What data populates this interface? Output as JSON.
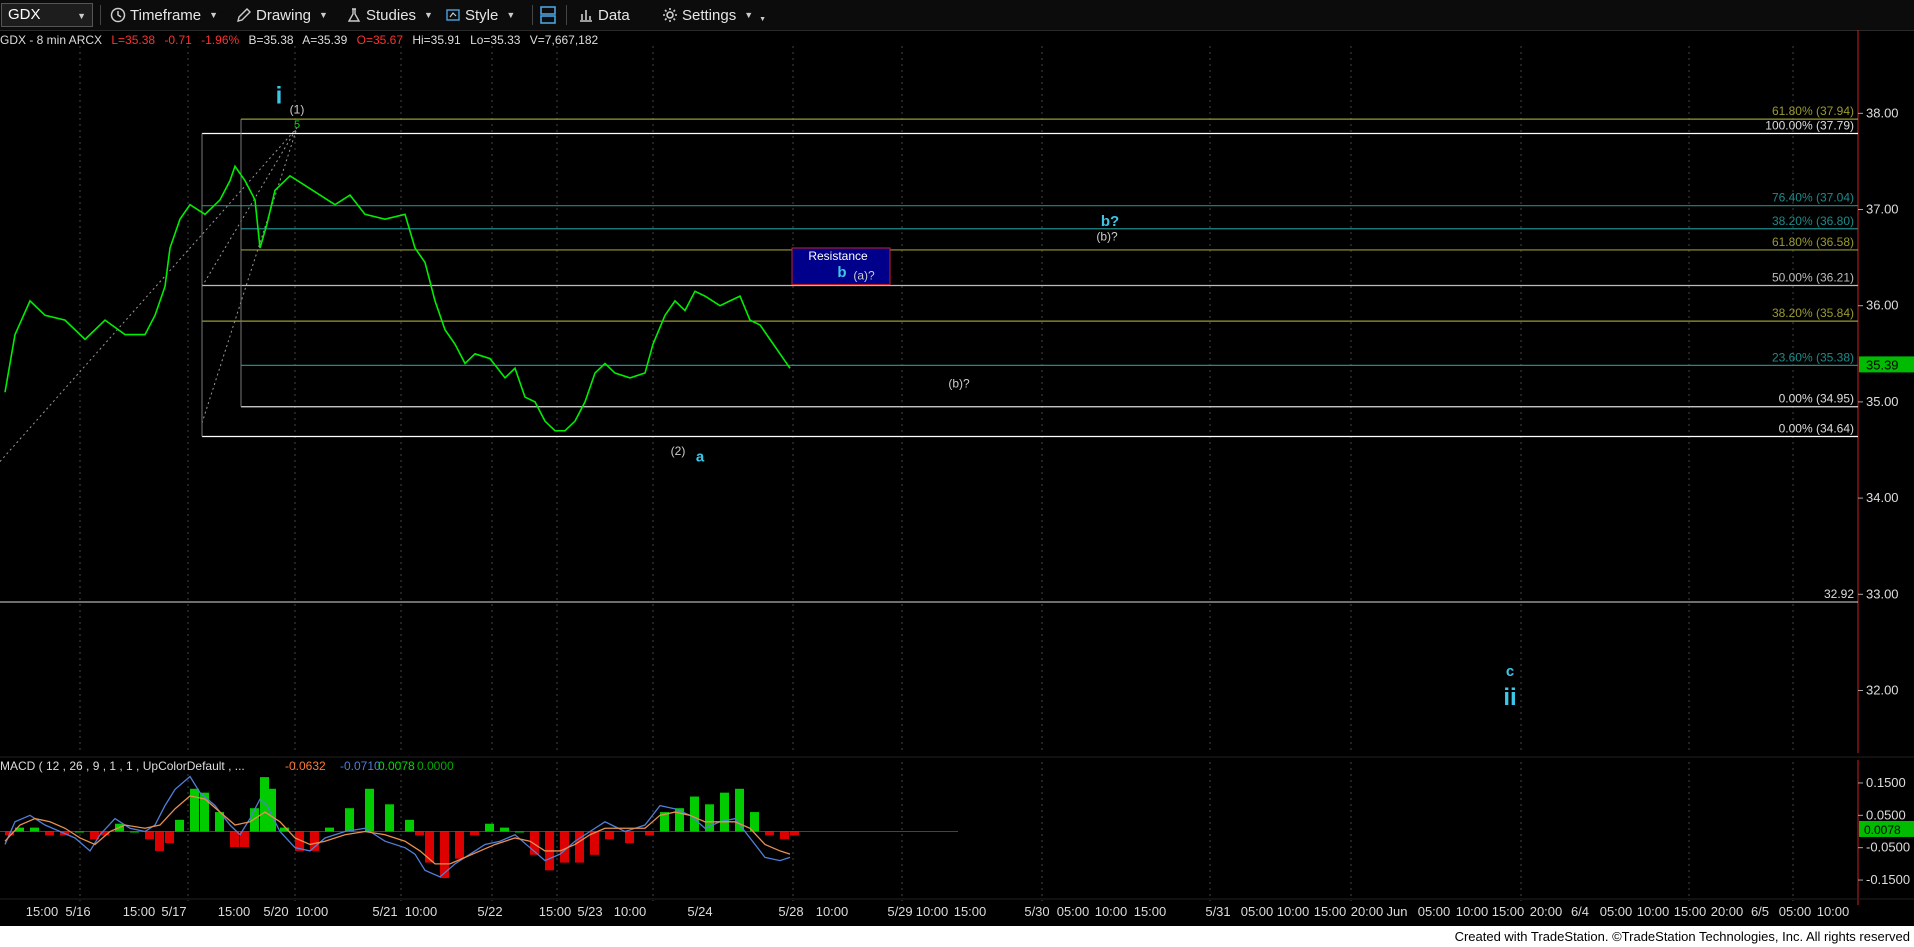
{
  "toolbar": {
    "symbol": "GDX",
    "timeframe_label": "Timeframe",
    "drawing_label": "Drawing",
    "studies_label": "Studies",
    "style_label": "Style",
    "data_label": "Data",
    "settings_label": "Settings"
  },
  "quote": {
    "symbol_info": "GDX - 8 min  ARCX",
    "last": "L=35.38",
    "change": "-0.71",
    "change_pct": "-1.96%",
    "bid": "B=35.38",
    "ask": "A=35.39",
    "open": "O=35.67",
    "high": "Hi=35.91",
    "low": "Lo=35.33",
    "volume": "V=7,667,182"
  },
  "footer": {
    "text": "Created with TradeStation. ©TradeStation Technologies, Inc. All rights reserved"
  },
  "colors": {
    "price": "#00ee00",
    "up_text": "#00dd00",
    "down_text": "#ff3030",
    "label_cyan": "#3ec6e8",
    "grid": "#444444",
    "macd_line": "#4f7fd8",
    "signal_line": "#e89050"
  },
  "chart_data": {
    "type": "line",
    "symbol": "GDX",
    "interval": "8 min",
    "current_price": "35.39",
    "y_ticks": [
      "38.00",
      "37.00",
      "36.00",
      "35.00",
      "34.00",
      "33.00",
      "32.00"
    ],
    "y_range": [
      31.35,
      38.7
    ],
    "x_ticks": [
      "15:00",
      "5/16",
      "15:00",
      "5/17",
      "15:00",
      "5/20",
      "10:00",
      "5/21",
      "10:00",
      "5/22",
      "15:00",
      "5/23",
      "10:00",
      "5/24",
      "5/28",
      "10:00",
      "5/29",
      "10:00",
      "15:00",
      "5/30",
      "05:00",
      "10:00",
      "15:00",
      "5/31",
      "05:00",
      "10:00",
      "15:00",
      "20:00",
      "Jun",
      "05:00",
      "10:00",
      "15:00",
      "20:00",
      "6/4",
      "05:00",
      "10:00",
      "15:00",
      "20:00",
      "6/5",
      "05:00",
      "10:00"
    ],
    "price_series": [
      [
        0,
        35.1
      ],
      [
        10,
        35.7
      ],
      [
        25,
        36.05
      ],
      [
        40,
        35.9
      ],
      [
        60,
        35.85
      ],
      [
        80,
        35.65
      ],
      [
        100,
        35.85
      ],
      [
        120,
        35.7
      ],
      [
        140,
        35.7
      ],
      [
        150,
        35.9
      ],
      [
        160,
        36.2
      ],
      [
        165,
        36.6
      ],
      [
        175,
        36.9
      ],
      [
        185,
        37.05
      ],
      [
        200,
        36.95
      ],
      [
        215,
        37.1
      ],
      [
        225,
        37.3
      ],
      [
        230,
        37.45
      ],
      [
        240,
        37.3
      ],
      [
        250,
        37.1
      ],
      [
        255,
        36.6
      ],
      [
        262,
        36.85
      ],
      [
        270,
        37.2
      ],
      [
        285,
        37.35
      ],
      [
        300,
        37.25
      ],
      [
        315,
        37.15
      ],
      [
        330,
        37.05
      ],
      [
        345,
        37.15
      ],
      [
        360,
        36.95
      ],
      [
        380,
        36.9
      ],
      [
        400,
        36.95
      ],
      [
        410,
        36.6
      ],
      [
        420,
        36.45
      ],
      [
        430,
        36.05
      ],
      [
        440,
        35.75
      ],
      [
        450,
        35.6
      ],
      [
        460,
        35.4
      ],
      [
        470,
        35.5
      ],
      [
        485,
        35.45
      ],
      [
        500,
        35.25
      ],
      [
        510,
        35.35
      ],
      [
        520,
        35.05
      ],
      [
        530,
        35.0
      ],
      [
        540,
        34.8
      ],
      [
        550,
        34.7
      ],
      [
        560,
        34.7
      ],
      [
        570,
        34.8
      ],
      [
        580,
        35.0
      ],
      [
        590,
        35.3
      ],
      [
        600,
        35.4
      ],
      [
        610,
        35.3
      ],
      [
        625,
        35.25
      ],
      [
        640,
        35.3
      ],
      [
        648,
        35.6
      ],
      [
        660,
        35.9
      ],
      [
        670,
        36.05
      ],
      [
        680,
        35.95
      ],
      [
        690,
        36.15
      ],
      [
        700,
        36.1
      ],
      [
        715,
        36.0
      ],
      [
        725,
        36.05
      ],
      [
        735,
        36.1
      ],
      [
        745,
        35.85
      ],
      [
        755,
        35.8
      ],
      [
        765,
        35.65
      ],
      [
        775,
        35.5
      ],
      [
        785,
        35.35
      ]
    ],
    "fib_lines": [
      {
        "label": "61.80% (37.94)",
        "value": 37.94,
        "color": "#9a9a30"
      },
      {
        "label": "100.00% (37.79)",
        "value": 37.79,
        "color": "#ffffff"
      },
      {
        "label": "76.40% (37.04)",
        "value": 37.04,
        "color": "#1e8a8a"
      },
      {
        "label": "38.20% (36.80)",
        "value": 36.8,
        "color": "#1e8a8a"
      },
      {
        "label": "61.80% (36.58)",
        "value": 36.58,
        "color": "#9a9a30"
      },
      {
        "label": "50.00% (36.21)",
        "value": 36.21,
        "color": "#bbbbbb"
      },
      {
        "label": "38.20% (35.84)",
        "value": 35.84,
        "color": "#9a9a30"
      },
      {
        "label": "23.60% (35.38)",
        "value": 35.38,
        "color": "#1e8a8a"
      },
      {
        "label": "0.00% (34.95)",
        "value": 34.95,
        "color": "#dddddd"
      },
      {
        "label": "0.00% (34.64)",
        "value": 34.64,
        "color": "#ffffff"
      }
    ],
    "support_line": {
      "label": "32.92",
      "value": 32.92
    },
    "resistance_box": {
      "label": "Resistance",
      "top": 36.6,
      "bottom": 36.22
    },
    "wave_labels": [
      {
        "text": "i",
        "value": 38.1
      },
      {
        "text": "(1)",
        "value": 38.0
      },
      {
        "text": "5",
        "value": 37.85
      },
      {
        "text": "(2)",
        "value": 34.45
      },
      {
        "text": "a",
        "value": 34.38
      },
      {
        "text": "b",
        "value": 36.3
      },
      {
        "text": "(a)?",
        "value": 36.27
      },
      {
        "text": "(b)?",
        "value": 35.15
      },
      {
        "text": "b?",
        "value": 36.83
      },
      {
        "text": "(b)?",
        "value": 36.68
      },
      {
        "text": "c",
        "value": 32.15
      },
      {
        "text": "ii",
        "value": 31.85
      }
    ],
    "macd": {
      "label": "MACD ( 12 , 26 , 9 , 1 , 1 , UpColorDefault , ...",
      "values": [
        "-0.0632",
        "-0.0710",
        "0.0078",
        "0.0000"
      ],
      "y_ticks": [
        "0.1500",
        "0.0500",
        "-0.0500",
        "-0.1500"
      ],
      "current": "0.0078",
      "y_range": [
        -0.19,
        0.19
      ],
      "macd_series": [
        [
          0,
          -0.04
        ],
        [
          10,
          0.03
        ],
        [
          25,
          0.05
        ],
        [
          40,
          0.02
        ],
        [
          55,
          0.0
        ],
        [
          70,
          -0.02
        ],
        [
          85,
          -0.06
        ],
        [
          95,
          -0.01
        ],
        [
          110,
          0.04
        ],
        [
          125,
          0.01
        ],
        [
          140,
          0.0
        ],
        [
          150,
          0.02
        ],
        [
          160,
          0.08
        ],
        [
          170,
          0.13
        ],
        [
          185,
          0.17
        ],
        [
          195,
          0.12
        ],
        [
          210,
          0.08
        ],
        [
          225,
          0.02
        ],
        [
          235,
          -0.01
        ],
        [
          245,
          0.04
        ],
        [
          255,
          0.1
        ],
        [
          262,
          0.08
        ],
        [
          275,
          0.0
        ],
        [
          290,
          -0.05
        ],
        [
          305,
          -0.06
        ],
        [
          320,
          -0.02
        ],
        [
          340,
          0.0
        ],
        [
          360,
          0.01
        ],
        [
          380,
          -0.03
        ],
        [
          400,
          -0.05
        ],
        [
          410,
          -0.07
        ],
        [
          420,
          -0.12
        ],
        [
          435,
          -0.14
        ],
        [
          450,
          -0.1
        ],
        [
          465,
          -0.07
        ],
        [
          480,
          -0.04
        ],
        [
          495,
          -0.03
        ],
        [
          510,
          -0.01
        ],
        [
          525,
          -0.05
        ],
        [
          540,
          -0.09
        ],
        [
          555,
          -0.07
        ],
        [
          570,
          -0.03
        ],
        [
          585,
          0.0
        ],
        [
          600,
          0.03
        ],
        [
          620,
          0.0
        ],
        [
          640,
          0.02
        ],
        [
          655,
          0.08
        ],
        [
          670,
          0.07
        ],
        [
          685,
          0.05
        ],
        [
          700,
          0.01
        ],
        [
          715,
          0.03
        ],
        [
          730,
          0.04
        ],
        [
          745,
          -0.02
        ],
        [
          760,
          -0.08
        ],
        [
          775,
          -0.09
        ],
        [
          785,
          -0.08
        ]
      ],
      "signal_series": [
        [
          0,
          -0.03
        ],
        [
          15,
          0.02
        ],
        [
          30,
          0.04
        ],
        [
          45,
          0.03
        ],
        [
          60,
          0.01
        ],
        [
          75,
          -0.02
        ],
        [
          90,
          -0.04
        ],
        [
          105,
          0.0
        ],
        [
          120,
          0.02
        ],
        [
          140,
          0.01
        ],
        [
          155,
          0.02
        ],
        [
          170,
          0.07
        ],
        [
          185,
          0.11
        ],
        [
          200,
          0.1
        ],
        [
          215,
          0.06
        ],
        [
          230,
          0.02
        ],
        [
          245,
          0.03
        ],
        [
          260,
          0.06
        ],
        [
          275,
          0.03
        ],
        [
          290,
          -0.02
        ],
        [
          305,
          -0.04
        ],
        [
          320,
          -0.03
        ],
        [
          340,
          -0.01
        ],
        [
          360,
          0.0
        ],
        [
          380,
          -0.01
        ],
        [
          400,
          -0.03
        ],
        [
          415,
          -0.06
        ],
        [
          430,
          -0.1
        ],
        [
          445,
          -0.1
        ],
        [
          460,
          -0.08
        ],
        [
          475,
          -0.06
        ],
        [
          490,
          -0.04
        ],
        [
          510,
          -0.02
        ],
        [
          525,
          -0.03
        ],
        [
          540,
          -0.06
        ],
        [
          555,
          -0.06
        ],
        [
          570,
          -0.04
        ],
        [
          585,
          -0.01
        ],
        [
          600,
          0.01
        ],
        [
          620,
          0.01
        ],
        [
          640,
          0.01
        ],
        [
          655,
          0.05
        ],
        [
          670,
          0.06
        ],
        [
          685,
          0.05
        ],
        [
          700,
          0.03
        ],
        [
          715,
          0.03
        ],
        [
          730,
          0.03
        ],
        [
          745,
          0.01
        ],
        [
          760,
          -0.04
        ],
        [
          775,
          -0.06
        ],
        [
          785,
          -0.07
        ]
      ]
    }
  }
}
